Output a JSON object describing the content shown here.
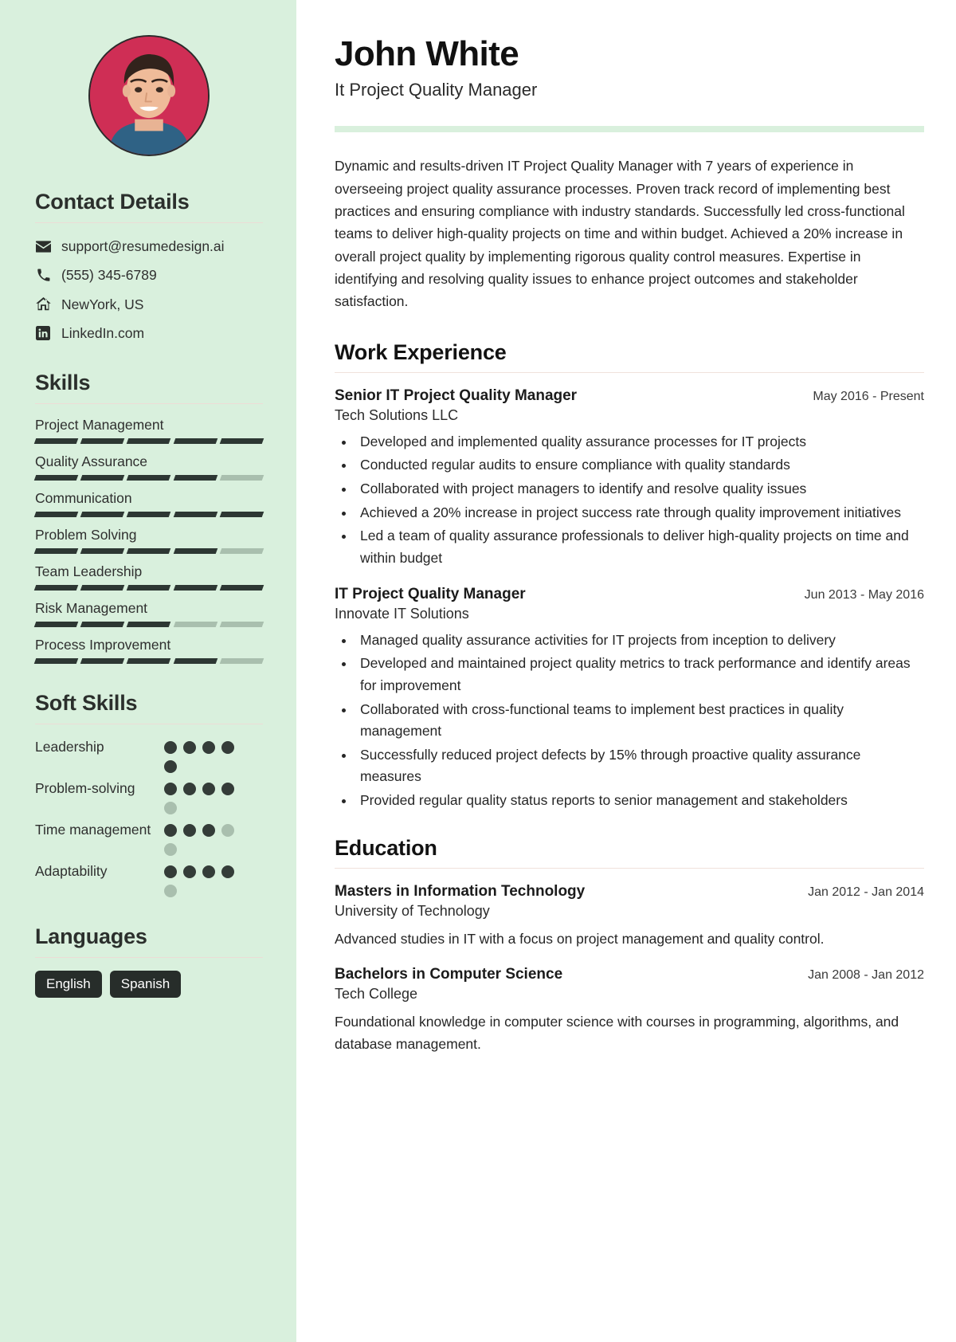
{
  "header": {
    "name": "John White",
    "job_title": "It Project Quality Manager"
  },
  "summary": "Dynamic and results-driven IT Project Quality Manager with 7 years of experience in overseeing project quality assurance processes. Proven track record of implementing best practices and ensuring compliance with industry standards. Successfully led cross-functional teams to deliver high-quality projects on time and within budget. Achieved a 20% increase in overall project quality by implementing rigorous quality control measures. Expertise in identifying and resolving quality issues to enhance project outcomes and stakeholder satisfaction.",
  "sidebar": {
    "contact": {
      "heading": "Contact Details",
      "items": [
        {
          "icon": "envelope-icon",
          "value": "support@resumedesign.ai"
        },
        {
          "icon": "phone-icon",
          "value": "(555) 345-6789"
        },
        {
          "icon": "home-icon",
          "value": "NewYork, US"
        },
        {
          "icon": "linkedin-icon",
          "value": "LinkedIn.com"
        }
      ]
    },
    "skills": {
      "heading": "Skills",
      "max": 5,
      "items": [
        {
          "label": "Project Management",
          "level": 5
        },
        {
          "label": "Quality Assurance",
          "level": 4
        },
        {
          "label": "Communication",
          "level": 5
        },
        {
          "label": "Problem Solving",
          "level": 4
        },
        {
          "label": "Team Leadership",
          "level": 5
        },
        {
          "label": "Risk Management",
          "level": 3
        },
        {
          "label": "Process Improvement",
          "level": 4
        }
      ]
    },
    "soft_skills": {
      "heading": "Soft Skills",
      "max": 5,
      "items": [
        {
          "label": "Leadership",
          "level": 5
        },
        {
          "label": "Problem-solving",
          "level": 4
        },
        {
          "label": "Time management",
          "level": 3
        },
        {
          "label": "Adaptability",
          "level": 4
        }
      ]
    },
    "languages": {
      "heading": "Languages",
      "items": [
        "English",
        "Spanish"
      ]
    }
  },
  "work_experience": {
    "heading": "Work Experience",
    "entries": [
      {
        "role": "Senior IT Project Quality Manager",
        "organization": "Tech Solutions LLC",
        "date": "May 2016 - Present",
        "bullets": [
          "Developed and implemented quality assurance processes for IT projects",
          "Conducted regular audits to ensure compliance with quality standards",
          "Collaborated with project managers to identify and resolve quality issues",
          "Achieved a 20% increase in project success rate through quality improvement initiatives",
          "Led a team of quality assurance professionals to deliver high-quality projects on time and within budget"
        ]
      },
      {
        "role": "IT Project Quality Manager",
        "organization": "Innovate IT Solutions",
        "date": "Jun 2013 - May 2016",
        "bullets": [
          "Managed quality assurance activities for IT projects from inception to delivery",
          "Developed and maintained project quality metrics to track performance and identify areas for improvement",
          "Collaborated with cross-functional teams to implement best practices in quality management",
          "Successfully reduced project defects by 15% through proactive quality assurance measures",
          "Provided regular quality status reports to senior management and stakeholders"
        ]
      }
    ]
  },
  "education": {
    "heading": "Education",
    "entries": [
      {
        "degree": "Masters in Information Technology",
        "institution": "University of Technology",
        "date": "Jan 2012 - Jan 2014",
        "description": "Advanced studies in IT with a focus on project management and quality control."
      },
      {
        "degree": "Bachelors in Computer Science",
        "institution": "Tech College",
        "date": "Jan 2008 - Jan 2012",
        "description": "Foundational knowledge in computer science with courses in programming, algorithms, and database management."
      }
    ]
  },
  "colors": {
    "sidebar_bg": "#d9f0dd",
    "accent_dark": "#2d3733",
    "accent_muted": "#a9bfae",
    "avatar_bg": "#cf2e55"
  }
}
